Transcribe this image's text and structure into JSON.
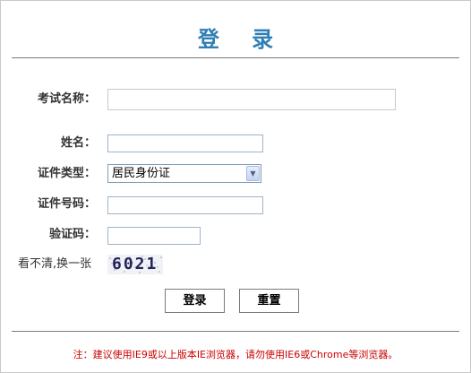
{
  "header": {
    "title": "登 录"
  },
  "form": {
    "exam_name": {
      "label": "考试名称：",
      "value": ""
    },
    "name": {
      "label": "姓名：",
      "value": ""
    },
    "id_type": {
      "label": "证件类型：",
      "selected": "居民身份证"
    },
    "id_number": {
      "label": "证件号码：",
      "value": ""
    },
    "captcha_input": {
      "label": "验证码：",
      "value": ""
    },
    "captcha": {
      "refresh_text": "看不清,换一张",
      "code": "6021"
    }
  },
  "buttons": {
    "login_label": "登录",
    "reset_label": "重置"
  },
  "footer": {
    "note": "注：建议使用IE9或以上版本IE浏览器，请勿使用IE6或Chrome等浏览器。"
  },
  "colors": {
    "title": "#2f7fb5",
    "note": "#cc0000",
    "divider": "#7a7a7a"
  }
}
